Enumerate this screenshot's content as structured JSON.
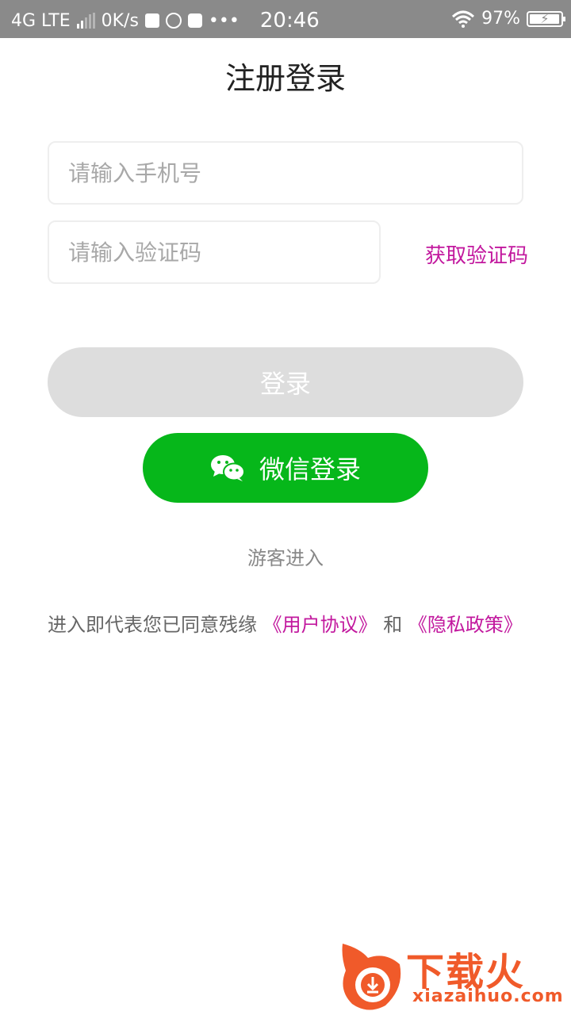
{
  "status_bar": {
    "network": "4G LTE",
    "speed": "0K/s",
    "more": "•••",
    "time": "20:46",
    "battery": "97%",
    "battery_level": 0.97
  },
  "page": {
    "title": "注册登录"
  },
  "form": {
    "phone_placeholder": "请输入手机号",
    "code_placeholder": "请输入验证码",
    "get_code": "获取验证码",
    "login": "登录",
    "wechat_login": "微信登录",
    "guest": "游客进入"
  },
  "agreement": {
    "prefix": "进入即代表您已同意残缘",
    "user_agreement": "《用户协议》",
    "and": "和",
    "privacy_policy": "《隐私政策》"
  },
  "watermark": {
    "brand": "下载火",
    "domain": "xiazaihuo.com"
  },
  "colors": {
    "accent": "#c2189e",
    "wechat_green": "#06b71a",
    "status_bar": "#8a8a8a",
    "disabled_button": "#dddddd",
    "watermark": "#f05a2a"
  }
}
